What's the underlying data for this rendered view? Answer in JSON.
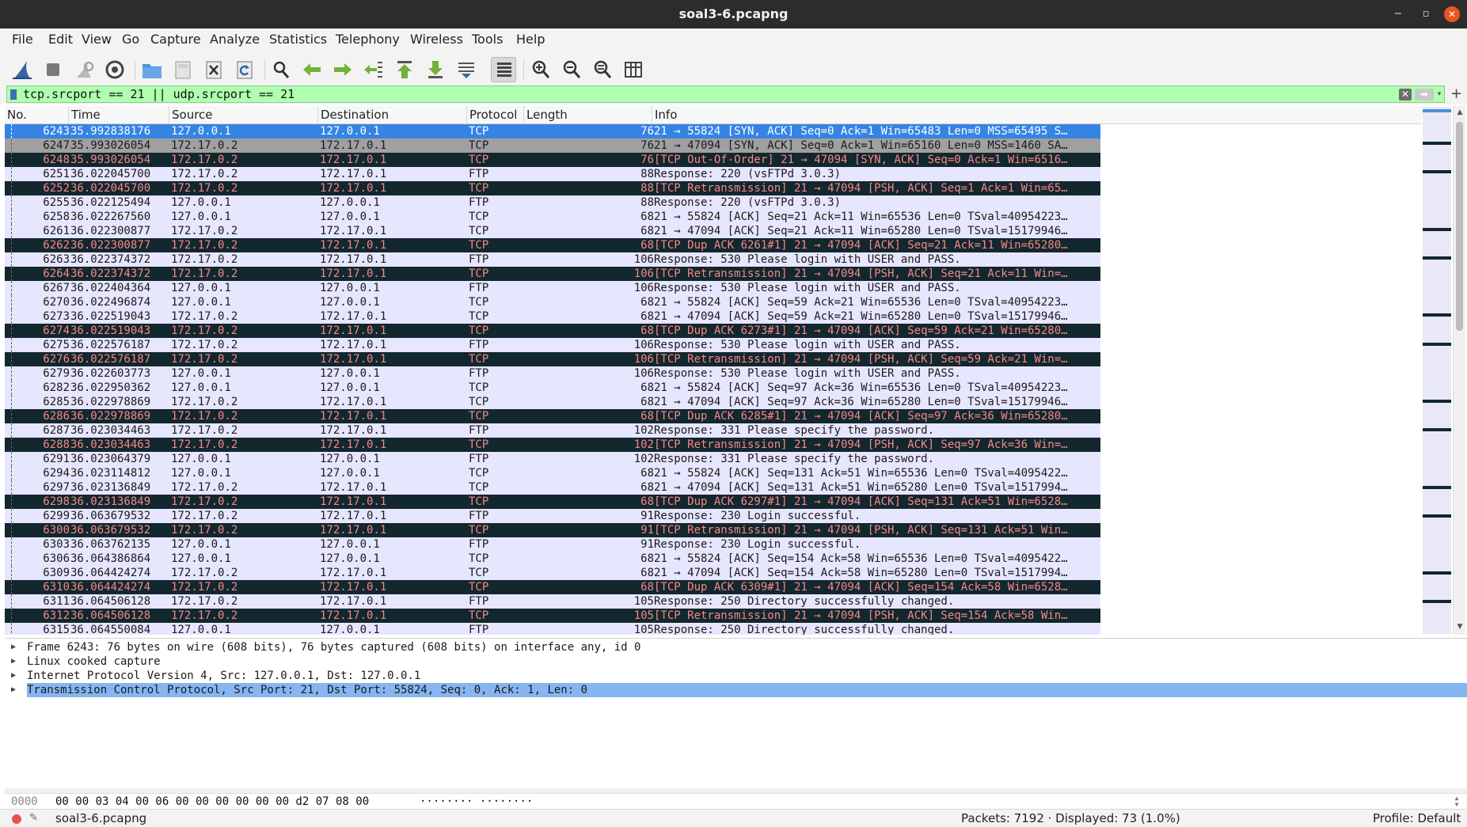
{
  "window": {
    "title": "soal3-6.pcapng",
    "minimize": "−",
    "maximize": "▫",
    "close": "✕"
  },
  "menu": [
    "File",
    "Edit",
    "View",
    "Go",
    "Capture",
    "Analyze",
    "Statistics",
    "Telephony",
    "Wireless",
    "Tools",
    "Help"
  ],
  "toolbar": [
    {
      "icon": "shark-fin-start-icon"
    },
    {
      "icon": "stop-capture-icon"
    },
    {
      "icon": "restart-capture-icon"
    },
    {
      "icon": "capture-options-icon"
    },
    {
      "icon": "open-file-icon"
    },
    {
      "icon": "save-file-icon"
    },
    {
      "icon": "close-file-icon"
    },
    {
      "icon": "reload-file-icon"
    },
    {
      "icon": "find-packet-icon"
    },
    {
      "icon": "go-back-icon"
    },
    {
      "icon": "go-forward-icon"
    },
    {
      "icon": "go-to-packet-icon"
    },
    {
      "icon": "go-first-icon"
    },
    {
      "icon": "go-last-icon"
    },
    {
      "icon": "autoscroll-icon"
    },
    {
      "icon": "colorize-icon"
    },
    {
      "icon": "zoom-in-icon"
    },
    {
      "icon": "zoom-out-icon"
    },
    {
      "icon": "zoom-normal-icon"
    },
    {
      "icon": "resize-columns-icon"
    }
  ],
  "filter": {
    "value": "tcp.srcport == 21 || udp.srcport == 21",
    "clear": "✕",
    "apply": "➡",
    "dropdown": "▾",
    "add": "+"
  },
  "columns": [
    "No.",
    "Time",
    "Source",
    "Destination",
    "Protocol",
    "Length",
    "Info"
  ],
  "colors": {
    "selected": "#3584e4",
    "tcp": "#e7e6ff",
    "ftp": "#e7e6ff",
    "bad_bg": "#12272e",
    "bad_fg": "#f78787",
    "sel_dark": "#a0a0a0"
  },
  "packets": [
    {
      "no": "6243",
      "time": "35.992838176",
      "src": "127.0.0.1",
      "dst": "127.0.0.1",
      "proto": "TCP",
      "len": "76",
      "info": "21 → 55824 [SYN, ACK] Seq=0 Ack=1 Win=65483 Len=0 MSS=65495 S…",
      "style": "sel"
    },
    {
      "no": "6247",
      "time": "35.993026054",
      "src": "172.17.0.2",
      "dst": "172.17.0.1",
      "proto": "TCP",
      "len": "76",
      "info": "21 → 47094 [SYN, ACK] Seq=0 Ack=1 Win=65160 Len=0 MSS=1460 SA…",
      "style": "gray"
    },
    {
      "no": "6248",
      "time": "35.993026054",
      "src": "172.17.0.2",
      "dst": "172.17.0.1",
      "proto": "TCP",
      "len": "76",
      "info": "[TCP Out-Of-Order] 21 → 47094 [SYN, ACK] Seq=0 Ack=1 Win=6516…",
      "style": "bad"
    },
    {
      "no": "6251",
      "time": "36.022045700",
      "src": "172.17.0.2",
      "dst": "172.17.0.1",
      "proto": "FTP",
      "len": "88",
      "info": "Response: 220 (vsFTPd 3.0.3)",
      "style": "norm"
    },
    {
      "no": "6252",
      "time": "36.022045700",
      "src": "172.17.0.2",
      "dst": "172.17.0.1",
      "proto": "TCP",
      "len": "88",
      "info": "[TCP Retransmission] 21 → 47094 [PSH, ACK] Seq=1 Ack=1 Win=65…",
      "style": "bad"
    },
    {
      "no": "6255",
      "time": "36.022125494",
      "src": "127.0.0.1",
      "dst": "127.0.0.1",
      "proto": "FTP",
      "len": "88",
      "info": "Response: 220 (vsFTPd 3.0.3)",
      "style": "norm"
    },
    {
      "no": "6258",
      "time": "36.022267560",
      "src": "127.0.0.1",
      "dst": "127.0.0.1",
      "proto": "TCP",
      "len": "68",
      "info": "21 → 55824 [ACK] Seq=21 Ack=11 Win=65536 Len=0 TSval=40954223…",
      "style": "norm"
    },
    {
      "no": "6261",
      "time": "36.022300877",
      "src": "172.17.0.2",
      "dst": "172.17.0.1",
      "proto": "TCP",
      "len": "68",
      "info": "21 → 47094 [ACK] Seq=21 Ack=11 Win=65280 Len=0 TSval=15179946…",
      "style": "norm"
    },
    {
      "no": "6262",
      "time": "36.022300877",
      "src": "172.17.0.2",
      "dst": "172.17.0.1",
      "proto": "TCP",
      "len": "68",
      "info": "[TCP Dup ACK 6261#1] 21 → 47094 [ACK] Seq=21 Ack=11 Win=65280…",
      "style": "bad"
    },
    {
      "no": "6263",
      "time": "36.022374372",
      "src": "172.17.0.2",
      "dst": "172.17.0.1",
      "proto": "FTP",
      "len": "106",
      "info": "Response: 530 Please login with USER and PASS.",
      "style": "norm"
    },
    {
      "no": "6264",
      "time": "36.022374372",
      "src": "172.17.0.2",
      "dst": "172.17.0.1",
      "proto": "TCP",
      "len": "106",
      "info": "[TCP Retransmission] 21 → 47094 [PSH, ACK] Seq=21 Ack=11 Win=…",
      "style": "bad"
    },
    {
      "no": "6267",
      "time": "36.022404364",
      "src": "127.0.0.1",
      "dst": "127.0.0.1",
      "proto": "FTP",
      "len": "106",
      "info": "Response: 530 Please login with USER and PASS.",
      "style": "norm"
    },
    {
      "no": "6270",
      "time": "36.022496874",
      "src": "127.0.0.1",
      "dst": "127.0.0.1",
      "proto": "TCP",
      "len": "68",
      "info": "21 → 55824 [ACK] Seq=59 Ack=21 Win=65536 Len=0 TSval=40954223…",
      "style": "norm"
    },
    {
      "no": "6273",
      "time": "36.022519043",
      "src": "172.17.0.2",
      "dst": "172.17.0.1",
      "proto": "TCP",
      "len": "68",
      "info": "21 → 47094 [ACK] Seq=59 Ack=21 Win=65280 Len=0 TSval=15179946…",
      "style": "norm"
    },
    {
      "no": "6274",
      "time": "36.022519043",
      "src": "172.17.0.2",
      "dst": "172.17.0.1",
      "proto": "TCP",
      "len": "68",
      "info": "[TCP Dup ACK 6273#1] 21 → 47094 [ACK] Seq=59 Ack=21 Win=65280…",
      "style": "bad"
    },
    {
      "no": "6275",
      "time": "36.022576187",
      "src": "172.17.0.2",
      "dst": "172.17.0.1",
      "proto": "FTP",
      "len": "106",
      "info": "Response: 530 Please login with USER and PASS.",
      "style": "norm"
    },
    {
      "no": "6276",
      "time": "36.022576187",
      "src": "172.17.0.2",
      "dst": "172.17.0.1",
      "proto": "TCP",
      "len": "106",
      "info": "[TCP Retransmission] 21 → 47094 [PSH, ACK] Seq=59 Ack=21 Win=…",
      "style": "bad"
    },
    {
      "no": "6279",
      "time": "36.022603773",
      "src": "127.0.0.1",
      "dst": "127.0.0.1",
      "proto": "FTP",
      "len": "106",
      "info": "Response: 530 Please login with USER and PASS.",
      "style": "norm"
    },
    {
      "no": "6282",
      "time": "36.022950362",
      "src": "127.0.0.1",
      "dst": "127.0.0.1",
      "proto": "TCP",
      "len": "68",
      "info": "21 → 55824 [ACK] Seq=97 Ack=36 Win=65536 Len=0 TSval=40954223…",
      "style": "norm"
    },
    {
      "no": "6285",
      "time": "36.022978869",
      "src": "172.17.0.2",
      "dst": "172.17.0.1",
      "proto": "TCP",
      "len": "68",
      "info": "21 → 47094 [ACK] Seq=97 Ack=36 Win=65280 Len=0 TSval=15179946…",
      "style": "norm"
    },
    {
      "no": "6286",
      "time": "36.022978869",
      "src": "172.17.0.2",
      "dst": "172.17.0.1",
      "proto": "TCP",
      "len": "68",
      "info": "[TCP Dup ACK 6285#1] 21 → 47094 [ACK] Seq=97 Ack=36 Win=65280…",
      "style": "bad"
    },
    {
      "no": "6287",
      "time": "36.023034463",
      "src": "172.17.0.2",
      "dst": "172.17.0.1",
      "proto": "FTP",
      "len": "102",
      "info": "Response: 331 Please specify the password.",
      "style": "norm"
    },
    {
      "no": "6288",
      "time": "36.023034463",
      "src": "172.17.0.2",
      "dst": "172.17.0.1",
      "proto": "TCP",
      "len": "102",
      "info": "[TCP Retransmission] 21 → 47094 [PSH, ACK] Seq=97 Ack=36 Win=…",
      "style": "bad"
    },
    {
      "no": "6291",
      "time": "36.023064379",
      "src": "127.0.0.1",
      "dst": "127.0.0.1",
      "proto": "FTP",
      "len": "102",
      "info": "Response: 331 Please specify the password.",
      "style": "norm"
    },
    {
      "no": "6294",
      "time": "36.023114812",
      "src": "127.0.0.1",
      "dst": "127.0.0.1",
      "proto": "TCP",
      "len": "68",
      "info": "21 → 55824 [ACK] Seq=131 Ack=51 Win=65536 Len=0 TSval=4095422…",
      "style": "norm"
    },
    {
      "no": "6297",
      "time": "36.023136849",
      "src": "172.17.0.2",
      "dst": "172.17.0.1",
      "proto": "TCP",
      "len": "68",
      "info": "21 → 47094 [ACK] Seq=131 Ack=51 Win=65280 Len=0 TSval=1517994…",
      "style": "norm"
    },
    {
      "no": "6298",
      "time": "36.023136849",
      "src": "172.17.0.2",
      "dst": "172.17.0.1",
      "proto": "TCP",
      "len": "68",
      "info": "[TCP Dup ACK 6297#1] 21 → 47094 [ACK] Seq=131 Ack=51 Win=6528…",
      "style": "bad"
    },
    {
      "no": "6299",
      "time": "36.063679532",
      "src": "172.17.0.2",
      "dst": "172.17.0.1",
      "proto": "FTP",
      "len": "91",
      "info": "Response: 230 Login successful.",
      "style": "norm"
    },
    {
      "no": "6300",
      "time": "36.063679532",
      "src": "172.17.0.2",
      "dst": "172.17.0.1",
      "proto": "TCP",
      "len": "91",
      "info": "[TCP Retransmission] 21 → 47094 [PSH, ACK] Seq=131 Ack=51 Win…",
      "style": "bad"
    },
    {
      "no": "6303",
      "time": "36.063762135",
      "src": "127.0.0.1",
      "dst": "127.0.0.1",
      "proto": "FTP",
      "len": "91",
      "info": "Response: 230 Login successful.",
      "style": "norm"
    },
    {
      "no": "6306",
      "time": "36.064386864",
      "src": "127.0.0.1",
      "dst": "127.0.0.1",
      "proto": "TCP",
      "len": "68",
      "info": "21 → 55824 [ACK] Seq=154 Ack=58 Win=65536 Len=0 TSval=4095422…",
      "style": "norm"
    },
    {
      "no": "6309",
      "time": "36.064424274",
      "src": "172.17.0.2",
      "dst": "172.17.0.1",
      "proto": "TCP",
      "len": "68",
      "info": "21 → 47094 [ACK] Seq=154 Ack=58 Win=65280 Len=0 TSval=1517994…",
      "style": "norm"
    },
    {
      "no": "6310",
      "time": "36.064424274",
      "src": "172.17.0.2",
      "dst": "172.17.0.1",
      "proto": "TCP",
      "len": "68",
      "info": "[TCP Dup ACK 6309#1] 21 → 47094 [ACK] Seq=154 Ack=58 Win=6528…",
      "style": "bad"
    },
    {
      "no": "6311",
      "time": "36.064506128",
      "src": "172.17.0.2",
      "dst": "172.17.0.1",
      "proto": "FTP",
      "len": "105",
      "info": "Response: 250 Directory successfully changed.",
      "style": "norm"
    },
    {
      "no": "6312",
      "time": "36.064506128",
      "src": "172.17.0.2",
      "dst": "172.17.0.1",
      "proto": "TCP",
      "len": "105",
      "info": "[TCP Retransmission] 21 → 47094 [PSH, ACK] Seq=154 Ack=58 Win…",
      "style": "bad"
    },
    {
      "no": "6315",
      "time": "36.064550084",
      "src": "127.0.0.1",
      "dst": "127.0.0.1",
      "proto": "FTP",
      "len": "105",
      "info": "Response: 250 Directory successfully changed.",
      "style": "norm"
    }
  ],
  "details": [
    {
      "text": "Frame 6243: 76 bytes on wire (608 bits), 76 bytes captured (608 bits) on interface any, id 0",
      "selected": false
    },
    {
      "text": "Linux cooked capture",
      "selected": false
    },
    {
      "text": "Internet Protocol Version 4, Src: 127.0.0.1, Dst: 127.0.0.1",
      "selected": false
    },
    {
      "text": "Transmission Control Protocol, Src Port: 21, Dst Port: 55824, Seq: 0, Ack: 1, Len: 0",
      "selected": true
    }
  ],
  "bytes": {
    "offset": "0000",
    "hex": "00 00 03 04 00 06 00 00  00 00 00 00 d2 07 08 00",
    "ascii": "········ ········"
  },
  "status": {
    "file": "soal3-6.pcapng",
    "packets": "Packets: 7192 · Displayed: 73 (1.0%)",
    "profile": "Profile: Default"
  }
}
